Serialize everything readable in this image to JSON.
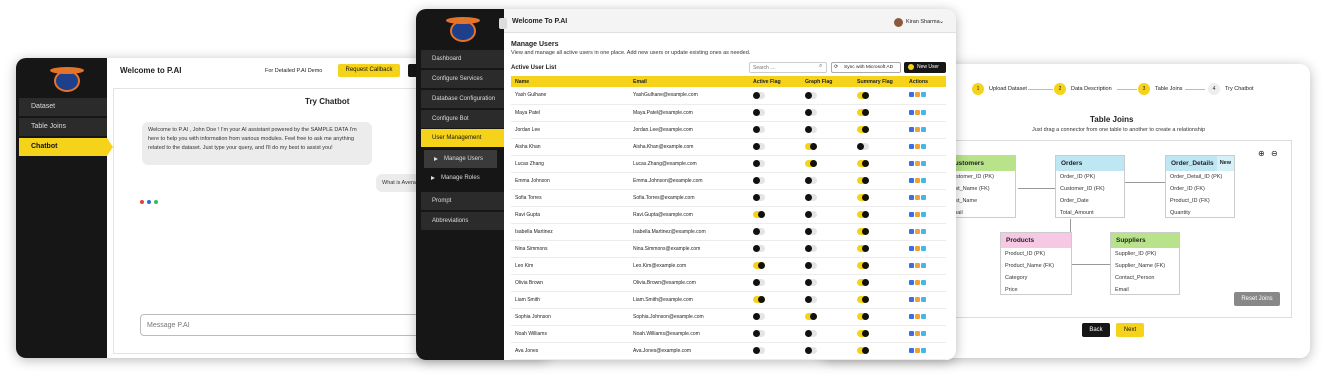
{
  "left_card": {
    "title": "Welcome to P.AI",
    "demo_text": "For Detailed P.AI Demo",
    "callback_button": "Request Callback",
    "nav": [
      "Dataset",
      "Table Joins",
      "Chatbot"
    ],
    "chat_heading": "Try Chatbot",
    "bot_message": "Welcome to P.AI , John Doe ! I'm your AI assistant powered by the SAMPLE DATA I'm here to help you with information from various modules. Feel free to ask me anything related to the dataset. Just type your query, and I'll do my best to assist you!",
    "user_message": "What is Avera",
    "message_placeholder": "Message P.AI"
  },
  "middle_card": {
    "header_title": "Welcome To P.AI",
    "user_name": "Kiran Sharma",
    "nav": [
      "Dashboard",
      "Configure Services",
      "Database Configuration",
      "Configure Bot",
      "User Management",
      "Manage Users",
      "Manage Roles",
      "Prompt",
      "Abbreviations"
    ],
    "page_title": "Manage Users",
    "page_subtitle": "View and manage all active users in one place. Add new users or update existing ones as needed.",
    "list_title": "Active User List",
    "search_placeholder": "Search ....",
    "sync_button": "Sync with Microsoft AD",
    "new_user_button": "New User",
    "columns": [
      "Name",
      "Email",
      "Active Flag",
      "Graph Flag",
      "Summary Flag",
      "Actions"
    ],
    "users": [
      {
        "name": "Yash Gulhane",
        "email": "YashGulhane@example.com",
        "active": false,
        "graph": false,
        "summary": true
      },
      {
        "name": "Maya Patel",
        "email": "Maya.Patel@example.com",
        "active": false,
        "graph": false,
        "summary": true
      },
      {
        "name": "Jordan Lee",
        "email": "Jordan.Lee@example.com",
        "active": false,
        "graph": false,
        "summary": true
      },
      {
        "name": "Aisha Khan",
        "email": "Aisha.Khan@example.com",
        "active": false,
        "graph": true,
        "summary": false
      },
      {
        "name": "Lucas Zhang",
        "email": "Lucas.Zhang@example.com",
        "active": false,
        "graph": true,
        "summary": true
      },
      {
        "name": "Emma Johnson",
        "email": "Emma.Johnson@example.com",
        "active": false,
        "graph": false,
        "summary": true
      },
      {
        "name": "Sofia Torres",
        "email": "Sofia.Torres@example.com",
        "active": false,
        "graph": false,
        "summary": true
      },
      {
        "name": "Ravi Gupta",
        "email": "Ravi.Gupta@example.com",
        "active": true,
        "graph": false,
        "summary": true
      },
      {
        "name": "Isabella Martinez",
        "email": "Isabella.Martinez@example.com",
        "active": false,
        "graph": false,
        "summary": true
      },
      {
        "name": "Nina Simmons",
        "email": "Nina.Simmons@example.com",
        "active": false,
        "graph": false,
        "summary": true
      },
      {
        "name": "Leo Kim",
        "email": "Leo.Kim@example.com",
        "active": true,
        "graph": false,
        "summary": true
      },
      {
        "name": "Olivia Brown",
        "email": "Olivia.Brown@example.com",
        "active": false,
        "graph": false,
        "summary": true
      },
      {
        "name": "Liam Smith",
        "email": "Liam.Smith@example.com",
        "active": true,
        "graph": false,
        "summary": true
      },
      {
        "name": "Sophia Johnson",
        "email": "Sophia.Johnson@example.com",
        "active": false,
        "graph": true,
        "summary": true
      },
      {
        "name": "Noah Williams",
        "email": "Noah.Williams@example.com",
        "active": false,
        "graph": false,
        "summary": true
      },
      {
        "name": "Ava Jones",
        "email": "Ava.Jones@example.com",
        "active": false,
        "graph": false,
        "summary": true
      }
    ]
  },
  "right_card": {
    "steps": [
      {
        "num": "1",
        "label": "Upload Dataset"
      },
      {
        "num": "2",
        "label": "Data Description"
      },
      {
        "num": "3",
        "label": "Table Joins"
      },
      {
        "num": "4",
        "label": "Try Chatbot"
      }
    ],
    "title": "Table Joins",
    "subtitle": "Just drag a connector from one table to another to create a relationship",
    "tables": {
      "customers": {
        "name": "Customers",
        "fields": [
          "Customer_ID (PK)",
          "First_Name (FK)",
          "Last_Name",
          "Email"
        ]
      },
      "orders": {
        "name": "Orders",
        "fields": [
          "Order_ID (PK)",
          "Customer_ID (FK)",
          "Order_Date",
          "Total_Amount"
        ]
      },
      "order_details": {
        "name": "Order_Details",
        "badge": "New",
        "fields": [
          "Order_Detail_ID (PK)",
          "Order_ID (FK)",
          "Product_ID (FK)",
          "Quantity"
        ]
      },
      "products": {
        "name": "Products",
        "fields": [
          "Product_ID (PK)",
          "Product_Name (FK)",
          "Category",
          "Price"
        ]
      },
      "suppliers": {
        "name": "Suppliers",
        "fields": [
          "Supplier_ID (PK)",
          "Supplier_Name (FK)",
          "Contact_Person",
          "Email"
        ]
      }
    },
    "reset_button": "Reset Joins",
    "back_button": "Back",
    "next_button": "Next"
  },
  "colors": {
    "accent": "#f5d31a",
    "sidebar": "#161616"
  }
}
